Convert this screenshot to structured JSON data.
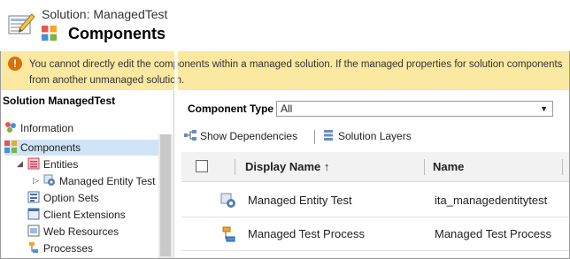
{
  "header": {
    "solution_label": "Solution: ManagedTest",
    "title": "Components"
  },
  "warning": {
    "icon": "warning-circle-icon",
    "line1": "You cannot directly edit the components within a managed solution. If the managed properties for solution components",
    "line2": "from another unmanaged solution."
  },
  "sidebar": {
    "title": "Solution ManagedTest",
    "items": [
      {
        "label": "Information",
        "icon": "information-icon"
      },
      {
        "label": "Components",
        "icon": "components-icon",
        "selected": true
      },
      {
        "label": "Entities",
        "icon": "entities-icon"
      },
      {
        "label": "Managed Entity Test",
        "icon": "entity-gear-icon"
      },
      {
        "label": "Option Sets",
        "icon": "option-sets-icon"
      },
      {
        "label": "Client Extensions",
        "icon": "client-extensions-icon"
      },
      {
        "label": "Web Resources",
        "icon": "web-resources-icon"
      },
      {
        "label": "Processes",
        "icon": "processes-icon"
      }
    ]
  },
  "main": {
    "component_type_label": "Component Type",
    "component_type_value": "All",
    "toolbar": {
      "show_dependencies": "Show Dependencies",
      "solution_layers": "Solution Layers"
    },
    "columns": [
      "Display Name ↑",
      "Name"
    ],
    "rows": [
      {
        "display_name": "Managed Entity Test",
        "name": "ita_managedentitytest",
        "icon": "entity-gear-icon"
      },
      {
        "display_name": "Managed Test Process",
        "name": "Managed Test Process",
        "icon": "process-icon"
      }
    ]
  },
  "colors": {
    "warning_bg": "#fbe9a2",
    "warning_icon": "#d8700d",
    "selected_bg": "#cfe4f7"
  }
}
